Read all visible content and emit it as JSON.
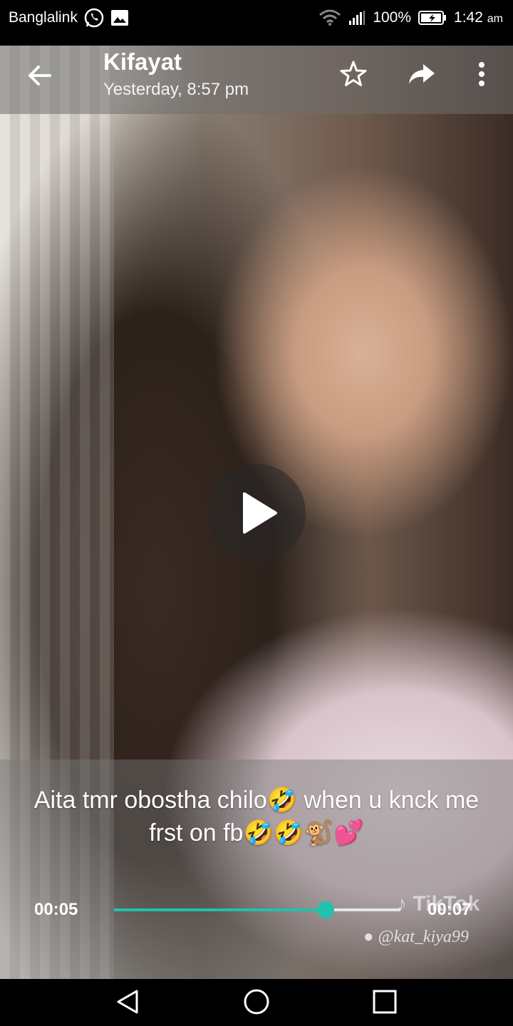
{
  "status_bar": {
    "carrier": "Banglalink",
    "battery": "100%",
    "time": "1:42",
    "ampm": "am",
    "icons": [
      "whatsapp-icon",
      "gallery-icon",
      "wifi-icon",
      "signal-icon",
      "battery-icon"
    ]
  },
  "header": {
    "contact_name": "Kifayat",
    "timestamp": "Yesterday, 8:57 pm",
    "icons": [
      "back-arrow-icon",
      "star-icon",
      "forward-icon",
      "more-vert-icon"
    ]
  },
  "media": {
    "caption": "Aita tmr obostha chilo🤣 when u knck me frst on fb🤣🤣🐒💕",
    "watermark_brand": "TikTok",
    "watermark_user": "@kat_kiya99"
  },
  "player": {
    "elapsed": "00:05",
    "duration": "00:07",
    "progress": 0.74,
    "accent_color": "#22c0ae"
  },
  "nav_bar": {
    "icons": [
      "back-triangle-icon",
      "home-circle-icon",
      "recents-square-icon"
    ]
  }
}
